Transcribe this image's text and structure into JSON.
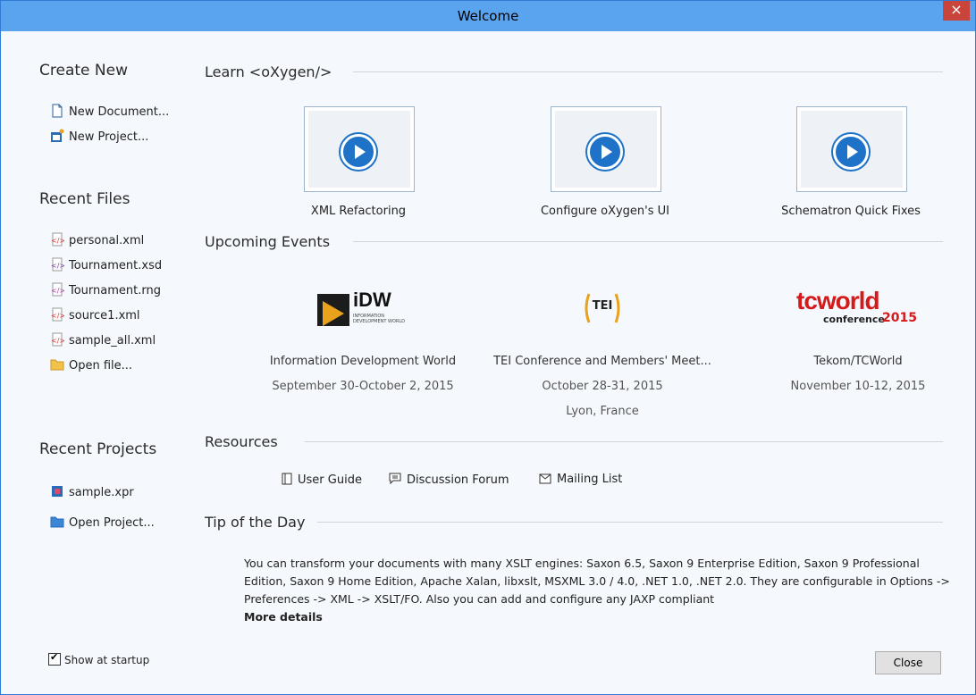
{
  "window": {
    "title": "Welcome",
    "close_glyph": "×"
  },
  "sidebar": {
    "create_new": {
      "heading": "Create New",
      "items": [
        {
          "label": "New Document...",
          "icon": "document-icon"
        },
        {
          "label": "New Project...",
          "icon": "project-icon"
        }
      ]
    },
    "recent_files": {
      "heading": "Recent Files",
      "items": [
        {
          "label": "personal.xml",
          "icon": "xml-file-icon"
        },
        {
          "label": "Tournament.xsd",
          "icon": "xsd-file-icon"
        },
        {
          "label": "Tournament.rng",
          "icon": "rng-file-icon"
        },
        {
          "label": "source1.xml",
          "icon": "xml-file-icon"
        },
        {
          "label": "sample_all.xml",
          "icon": "xml-file-icon"
        },
        {
          "label": "Open file...",
          "icon": "folder-icon"
        }
      ]
    },
    "recent_projects": {
      "heading": "Recent Projects",
      "items": [
        {
          "label": "sample.xpr",
          "icon": "xpr-file-icon"
        },
        {
          "label": "Open Project...",
          "icon": "folder-icon"
        }
      ]
    },
    "show_at_startup": {
      "label": "Show at startup",
      "checked": true
    }
  },
  "learn": {
    "heading": "Learn <oXygen/>",
    "videos": [
      {
        "caption": "XML Refactoring"
      },
      {
        "caption": "Configure oXygen's UI"
      },
      {
        "caption": "Schematron Quick Fixes"
      }
    ]
  },
  "events": {
    "heading": "Upcoming Events",
    "items": [
      {
        "logo_text": "iDW",
        "logo_sub": "INFORMATION DEVELOPMENT WORLD",
        "name": "Information Development World",
        "date": "September 30-October 2, 2015",
        "place": ""
      },
      {
        "logo_text": "TEI",
        "name": "TEI Conference and Members' Meet...",
        "date": "October 28-31, 2015",
        "place": "Lyon, France"
      },
      {
        "logo_text": "tcworld",
        "logo_sub": "conference",
        "logo_year": "2015",
        "name": "Tekom/TCWorld",
        "date": "November 10-12, 2015",
        "place": ""
      }
    ]
  },
  "resources": {
    "heading": "Resources",
    "links": [
      {
        "label": "User Guide",
        "icon": "book-icon"
      },
      {
        "label": "Discussion Forum",
        "icon": "chat-icon"
      },
      {
        "label": "Mailing List",
        "icon": "mail-icon"
      }
    ]
  },
  "tip": {
    "heading": "Tip of the Day",
    "text": "You can transform your documents with many XSLT engines: Saxon 6.5, Saxon 9 Enterprise Edition, Saxon 9 Professional Edition, Saxon 9 Home Edition, Apache Xalan, libxslt, MSXML 3.0 / 4.0, .NET 1.0, .NET 2.0. They are configurable in Options -> Preferences -> XML -> XSLT/FO. Also you can add and configure any JAXP compliant",
    "more": "More details"
  },
  "buttons": {
    "close": "Close"
  },
  "colors": {
    "titlebar": "#5aa4ef",
    "close_red": "#c9453c",
    "accent_blue": "#1e73c8"
  }
}
